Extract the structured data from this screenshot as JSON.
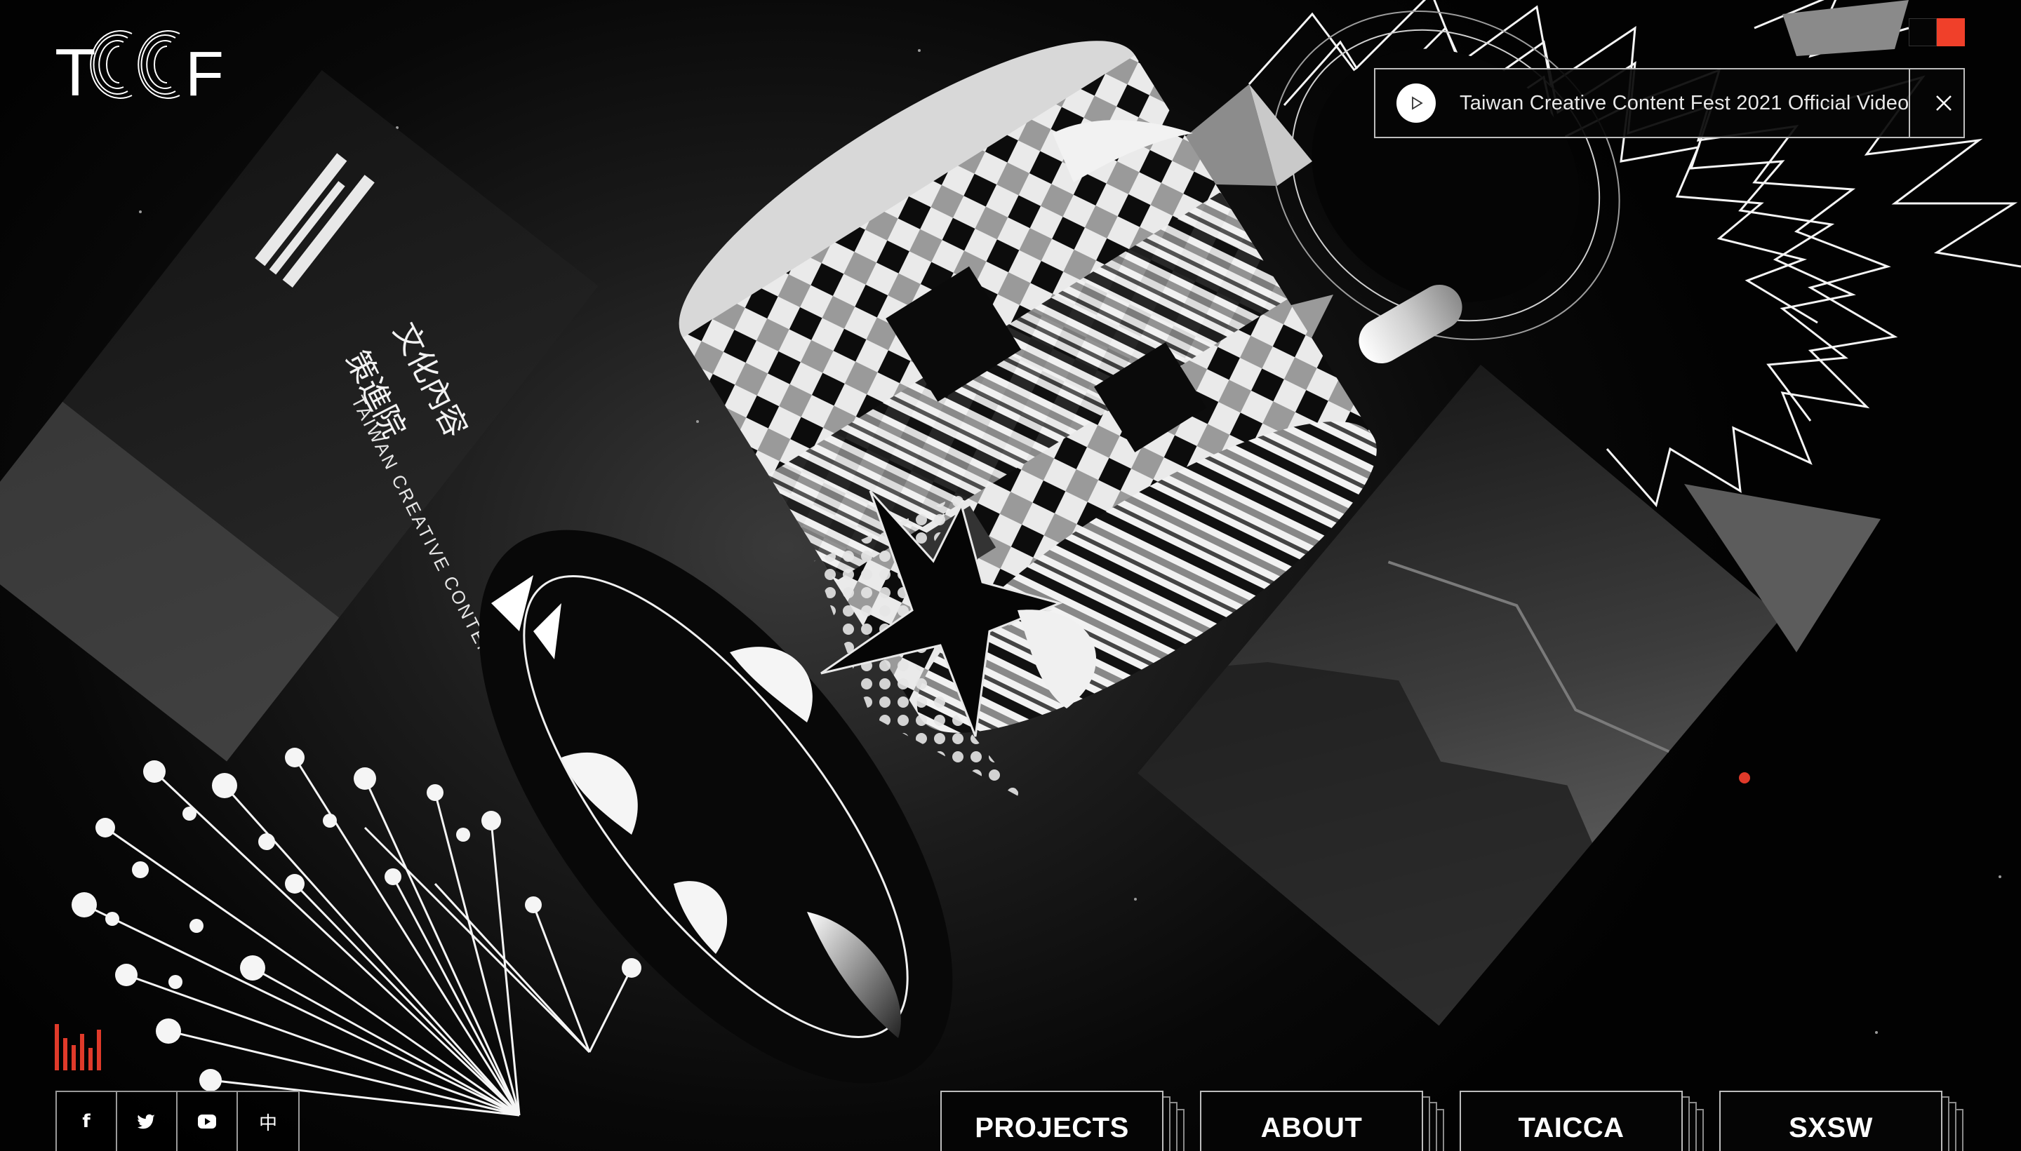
{
  "brand": {
    "logo_text": "TCCCF"
  },
  "theme_swatches": [
    {
      "name": "dark",
      "color": "#050505"
    },
    {
      "name": "accent",
      "color": "#f0402a"
    }
  ],
  "video_banner": {
    "title": "Taiwan Creative Content Fest 2021 Official Video",
    "play_icon": "play-icon",
    "close_icon": "close-icon"
  },
  "sound_toggle": {
    "icon": "sound-bars-icon",
    "color": "#e03a2a"
  },
  "social": [
    {
      "name": "facebook",
      "icon": "facebook-icon",
      "label": "f"
    },
    {
      "name": "twitter",
      "icon": "twitter-icon",
      "label": ""
    },
    {
      "name": "youtube",
      "icon": "youtube-icon",
      "label": ""
    },
    {
      "name": "language",
      "icon": "language-icon",
      "label": "中"
    }
  ],
  "nav": [
    {
      "label": "PROJECTS"
    },
    {
      "label": "ABOUT"
    },
    {
      "label": "TAICCA"
    },
    {
      "label": "SXSW"
    }
  ],
  "scene": {
    "agency_card": {
      "chinese_lines": [
        "文化內容",
        "策進院"
      ],
      "english": "TAIWAN CREATIVE CONTENT AGENCY"
    },
    "accent_dot_color": "#e03a2a"
  }
}
